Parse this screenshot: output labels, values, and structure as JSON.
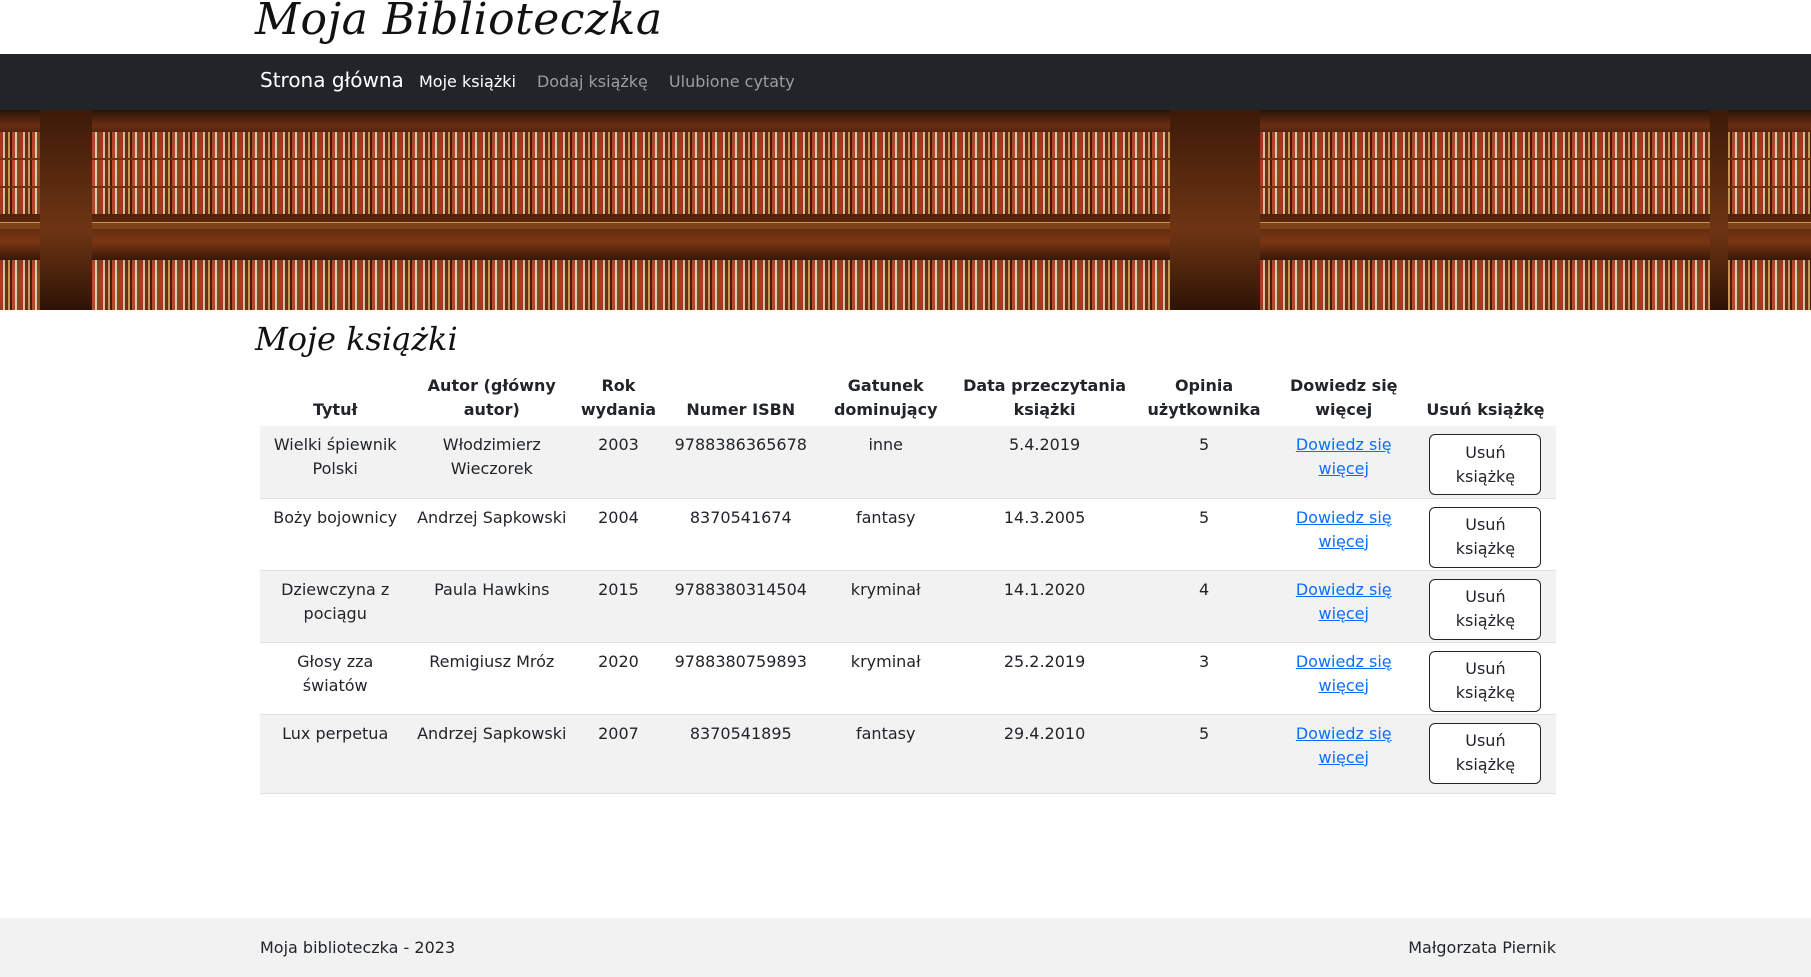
{
  "site": {
    "brand_title": "Moja Biblioteczka"
  },
  "navbar": {
    "brand": "Strona główna",
    "links": [
      {
        "label": "Moje książki",
        "active": true
      },
      {
        "label": "Dodaj książkę",
        "active": false
      },
      {
        "label": "Ulubione cytaty",
        "active": false
      }
    ]
  },
  "page": {
    "title": "Moje książki"
  },
  "table": {
    "headers": {
      "title": "Tytuł",
      "author": "Autor (główny autor)",
      "year": "Rok wydania",
      "isbn": "Numer ISBN",
      "genre": "Gatunek dominujący",
      "read_date": "Data przeczytania książki",
      "rating": "Opinia użytkownika",
      "more": "Dowiedz się więcej",
      "delete": "Usuń książkę"
    },
    "rows": [
      {
        "title": "Wielki śpiewnik Polski",
        "author": "Włodzimierz Wieczorek",
        "year": "2003",
        "isbn": "9788386365678",
        "genre": "inne",
        "read_date": "5.4.2019",
        "rating": "5",
        "more": "Dowiedz się więcej",
        "delete": "Usuń książkę"
      },
      {
        "title": "Boży bojownicy",
        "author": "Andrzej Sapkowski",
        "year": "2004",
        "isbn": "8370541674",
        "genre": "fantasy",
        "read_date": "14.3.2005",
        "rating": "5",
        "more": "Dowiedz się więcej",
        "delete": "Usuń książkę"
      },
      {
        "title": "Dziewczyna z pociągu",
        "author": "Paula Hawkins",
        "year": "2015",
        "isbn": "9788380314504",
        "genre": "kryminał",
        "read_date": "14.1.2020",
        "rating": "4",
        "more": "Dowiedz się więcej",
        "delete": "Usuń książkę"
      },
      {
        "title": "Głosy zza światów",
        "author": "Remigiusz Mróz",
        "year": "2020",
        "isbn": "9788380759893",
        "genre": "kryminał",
        "read_date": "25.2.2019",
        "rating": "3",
        "more": "Dowiedz się więcej",
        "delete": "Usuń książkę"
      },
      {
        "title": "Lux perpetua",
        "author": "Andrzej Sapkowski",
        "year": "2007",
        "isbn": "8370541895",
        "genre": "fantasy",
        "read_date": "29.4.2010",
        "rating": "5",
        "more": "Dowiedz się więcej",
        "delete": "Usuń książkę"
      }
    ]
  },
  "footer": {
    "left": "Moja biblioteczka - 2023",
    "right": "Małgorzata Piernik"
  },
  "colors": {
    "navbar": "#212529",
    "link": "#0d6efd",
    "stripe": "#f2f2f2",
    "footer": "#f2f2f2"
  }
}
